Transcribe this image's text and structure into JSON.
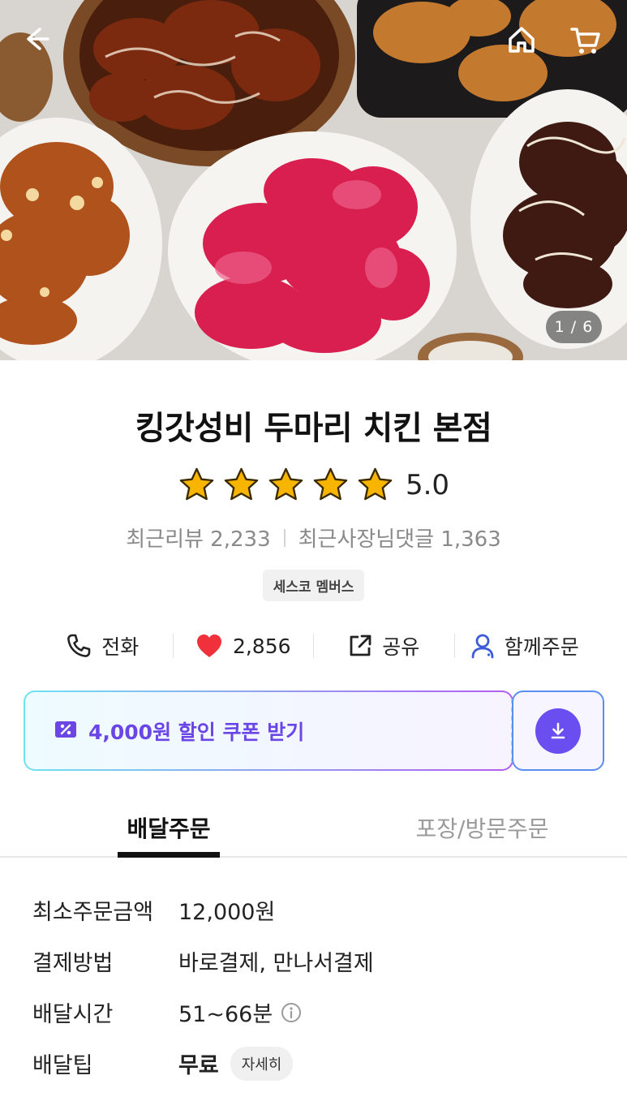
{
  "hero": {
    "pager": "1 / 6",
    "icons": [
      "back-arrow-icon",
      "home-icon",
      "cart-icon"
    ]
  },
  "store": {
    "title": "킹갓성비 두마리 치킨 본점",
    "rating": "5.0",
    "stars": 5,
    "recent_reviews": "최근리뷰 2,233",
    "owner_replies": "최근사장님댓글 1,363",
    "badge": "세스코 멤버스"
  },
  "actions": {
    "call": "전화",
    "likes": "2,856",
    "share": "공유",
    "group_order": "함께주문"
  },
  "coupon": {
    "label": "4,000원 할인 쿠폰 받기"
  },
  "tabs": {
    "delivery": "배달주문",
    "pickup": "포장/방문주문"
  },
  "info": {
    "min_order_label": "최소주문금액",
    "min_order_value": "12,000원",
    "payment_label": "결제방법",
    "payment_value": "바로결제, 만나서결제",
    "delivery_time_label": "배달시간",
    "delivery_time_value": "51~66분",
    "delivery_tip_label": "배달팁",
    "delivery_tip_value": "무료",
    "detail_button": "자세히"
  },
  "colors": {
    "accent_purple": "#6b46e6",
    "like_red": "#f0303a",
    "group_blue": "#3b5bdb",
    "star_gold": "#f7b500"
  }
}
